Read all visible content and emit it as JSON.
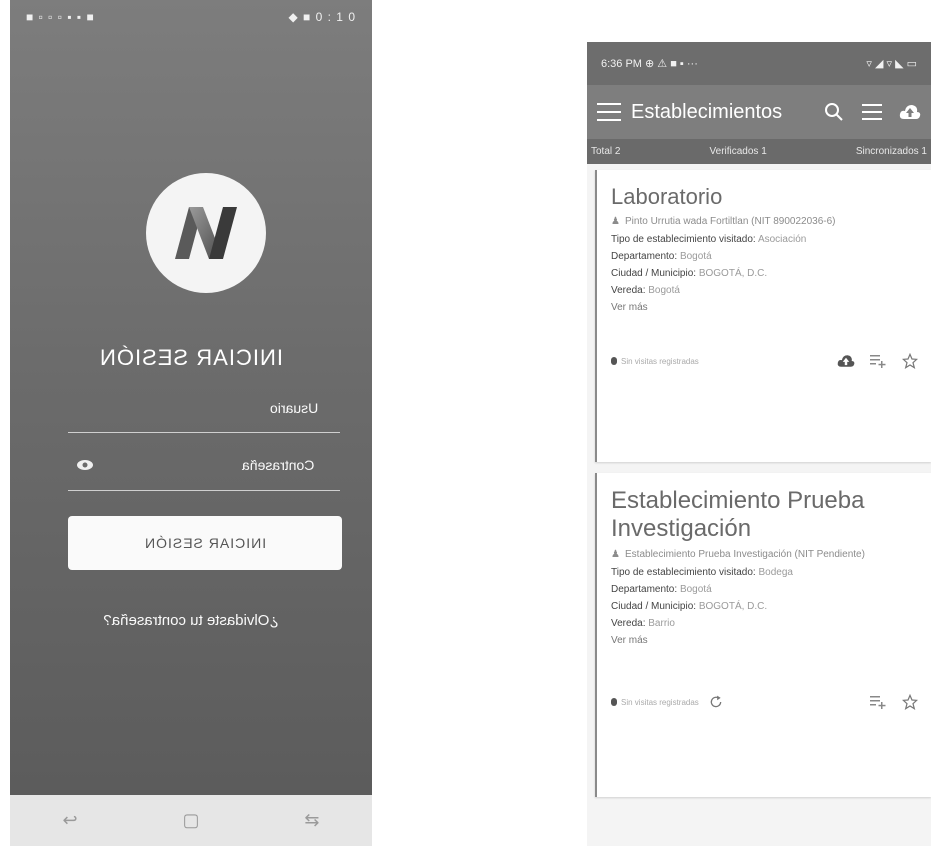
{
  "login_screen": {
    "status_left": "■ ▫ ▫ ▫ ▪ ▪ ■",
    "status_right": "◆ ■ 0 : 1 0",
    "title": "INICIAR SESIÓN",
    "username_label": "Usuario",
    "password_label": "Contraseña",
    "login_button": "INICIAR SESIÓN",
    "forgot_password": "¿Olvidaste tu contraseña?",
    "nav_back": "↩",
    "nav_home": "▢",
    "nav_recent": "⇆"
  },
  "list_screen": {
    "status_time": "6:36 PM ⊕ ⚠ ■ ▪ ···",
    "status_icons": "▿ ◢ ▿ ◣ ▭",
    "app_title": "Establecimientos",
    "tabs": [
      "Total 2",
      "Verificados 1",
      "Sincronizados 1"
    ],
    "cards": [
      {
        "title": "Laboratorio",
        "owner": "Pinto Urrutia wada Fortiltlan  (NIT  890022036-6)",
        "type_label": "Tipo de establecimiento visitado:",
        "type_value": "Asociación",
        "dept_label": "Departamento:",
        "dept_value": "Bogotá",
        "city_label": "Ciudad / Municipio:",
        "city_value": "BOGOTÁ, D.C.",
        "vereda_label": "Vereda:",
        "vereda_value": "Bogotá",
        "more": "Ver más",
        "status": "Sin visitas registradas"
      },
      {
        "title": "Establecimiento Prueba Investigación",
        "owner": "Establecimiento Prueba Investigación (NIT Pendiente)",
        "type_label": "Tipo de establecimiento visitado:",
        "type_value": "Bodega",
        "dept_label": "Departamento:",
        "dept_value": "Bogotá",
        "city_label": "Ciudad / Municipio:",
        "city_value": "BOGOTÁ, D.C.",
        "vereda_label": "Vereda:",
        "vereda_value": "Barrio",
        "more": "Ver más",
        "status": "Sin visitas registradas"
      }
    ]
  },
  "colors": {
    "login_bg": "#6b6b6b",
    "appbar": "#7e7e7e",
    "tabsbar": "#6a6a6a"
  },
  "icons": {
    "logo": "app-logo",
    "eye": "eye-icon",
    "menu": "hamburger-menu-icon",
    "search": "search-icon",
    "list": "list-icon",
    "upload": "cloud-upload-icon",
    "person": "person-icon",
    "playlist_add": "playlist-add-icon",
    "star": "star-icon",
    "refresh": "refresh-icon"
  }
}
